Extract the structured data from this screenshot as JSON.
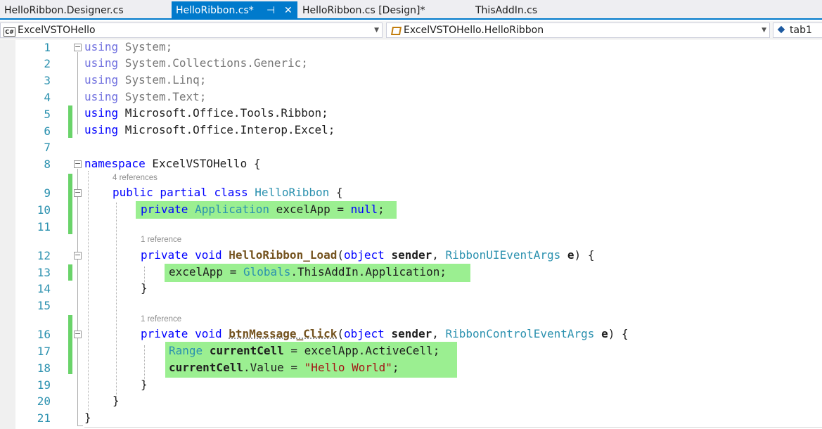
{
  "tabs": [
    {
      "label": "HelloRibbon.Designer.cs",
      "active": false
    },
    {
      "label": "HelloRibbon.cs*",
      "active": true
    },
    {
      "label": "HelloRibbon.cs [Design]*",
      "active": false
    },
    {
      "label": "ThisAddIn.cs",
      "active": false
    }
  ],
  "tab_pin_glyph": "⊣",
  "tab_close_glyph": "✕",
  "navbar": {
    "project_icon_text": "C#",
    "project": "ExcelVSTOHello",
    "type": "ExcelVSTOHello.HelloRibbon",
    "member": "tab1"
  },
  "line_numbers": [
    "1",
    "2",
    "3",
    "4",
    "5",
    "6",
    "7",
    "8",
    "9",
    "10",
    "11",
    "12",
    "13",
    "14",
    "15",
    "16",
    "17",
    "18",
    "19",
    "20",
    "21"
  ],
  "codelens": {
    "class_refs": "4 references",
    "load_refs": "1 reference",
    "click_refs": "1 reference"
  },
  "code": {
    "l1_kw": "using",
    "l1_rest": " System;",
    "l2_kw": "using",
    "l2_rest": " System.Collections.Generic;",
    "l3_kw": "using",
    "l3_rest": " System.Linq;",
    "l4_kw": "using",
    "l4_rest": " System.Text;",
    "l5_kw": "using",
    "l5_rest": " Microsoft.Office.Tools.Ribbon;",
    "l6_kw": "using",
    "l6_rest": " Microsoft.Office.Interop.Excel;",
    "l8_kw": "namespace",
    "l8_rest": " ExcelVSTOHello {",
    "l9_kw": "public partial class",
    "l9_type": "HelloRibbon",
    "l9_rest": " {",
    "l10_kw": "private",
    "l10_type": "Application",
    "l10_mid": " excelApp = ",
    "l10_kw2": "null",
    "l10_end": ";",
    "l12_kw": "private void",
    "l12_fn": "HelloRibbon_Load",
    "l12_a": "(",
    "l12_kw2": "object",
    "l12_p1": "sender",
    "l12_b": ", ",
    "l12_type": "RibbonUIEventArgs",
    "l12_p2": "e",
    "l12_end": ") {",
    "l13_a": "excelApp = ",
    "l13_type": "Globals",
    "l13_rest": ".ThisAddIn.Application;",
    "l14": "}",
    "l16_kw": "private void",
    "l16_fn": "btnMessage_Click",
    "l16_a": "(",
    "l16_kw2": "object",
    "l16_p1": "sender",
    "l16_b": ", ",
    "l16_type": "RibbonControlEventArgs",
    "l16_p2": "e",
    "l16_end": ") {",
    "l17_type": "Range",
    "l17_var": "currentCell",
    "l17_rest": " = excelApp.ActiveCell;",
    "l18_var": "currentCell",
    "l18_mid": ".Value = ",
    "l18_str": "\"Hello World\"",
    "l18_end": ";",
    "l19": "}",
    "l20": "}",
    "l21": "}"
  },
  "colors": {
    "accent": "#007acc",
    "line_number": "#2b91af",
    "keyword": "#0000ff",
    "type": "#2b91af",
    "method": "#74531f",
    "string": "#a31515",
    "highlight": "#9bef91",
    "change_bar": "#6ad36a"
  }
}
